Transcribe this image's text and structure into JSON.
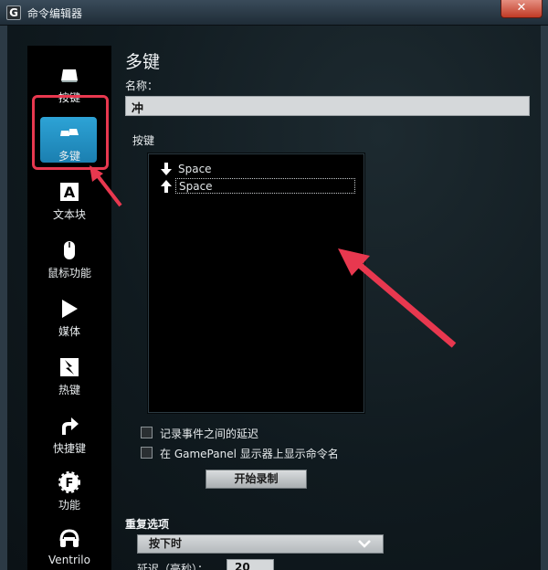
{
  "window": {
    "title": "命令编辑器",
    "app_icon_letter": "G",
    "close_symbol": "✕"
  },
  "sidebar": {
    "items": [
      {
        "label": "按键",
        "icon": "keyboard-key-icon"
      },
      {
        "label": "多键",
        "icon": "multi-key-icon",
        "active": true
      },
      {
        "label": "文本块",
        "icon": "text-block-icon"
      },
      {
        "label": "鼠标功能",
        "icon": "mouse-icon"
      },
      {
        "label": "媒体",
        "icon": "play-icon"
      },
      {
        "label": "热键",
        "icon": "hotkey-icon"
      },
      {
        "label": "快捷键",
        "icon": "shortcut-arrow-icon"
      },
      {
        "label": "功能",
        "icon": "function-gear-icon"
      },
      {
        "label": "Ventrilo",
        "icon": "headset-icon"
      }
    ]
  },
  "main": {
    "title": "多键",
    "name_label": "名称：",
    "name_value": "冲",
    "keys_label": "按键",
    "keys": [
      {
        "direction": "down",
        "key": "Space"
      },
      {
        "direction": "up",
        "key": "Space",
        "selected": true
      }
    ],
    "options": {
      "record_delays": "记录事件之间的延迟",
      "show_on_gamepanel": "在 GamePanel 显示器上显示命令名"
    },
    "record_button": "开始录制",
    "repeat_label": "重复选项",
    "repeat_value": "按下时",
    "delay_label": "延迟（毫秒）：",
    "delay_value": "20"
  },
  "colors": {
    "accent": "#2196cf",
    "annotation": "#e8384f",
    "sidebar_bg": "#000000"
  }
}
